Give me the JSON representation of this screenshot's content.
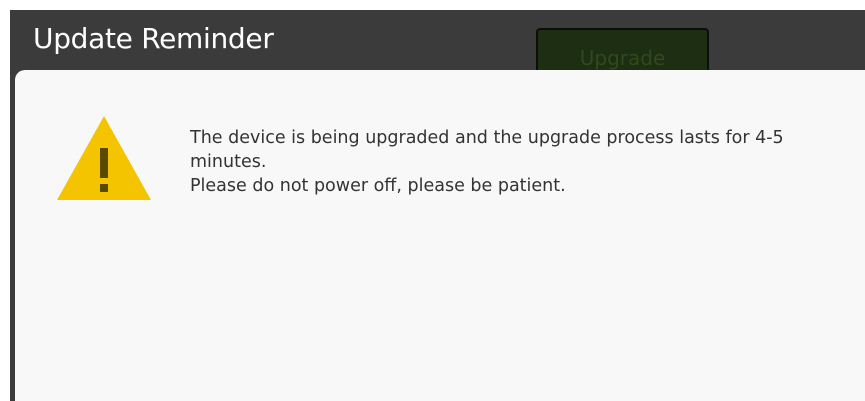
{
  "window": {
    "title": "Update Reminder",
    "background_color": "#3b3b3b"
  },
  "upgrade_button": {
    "label": "Upgrade",
    "state": "disabled"
  },
  "dialog": {
    "icon": "warning-triangle-icon",
    "icon_color": "#f5c400",
    "message_lines": [
      "The device is being upgraded and the upgrade process lasts for 4-5 minutes.",
      "Please do not power off, please be patient."
    ]
  }
}
